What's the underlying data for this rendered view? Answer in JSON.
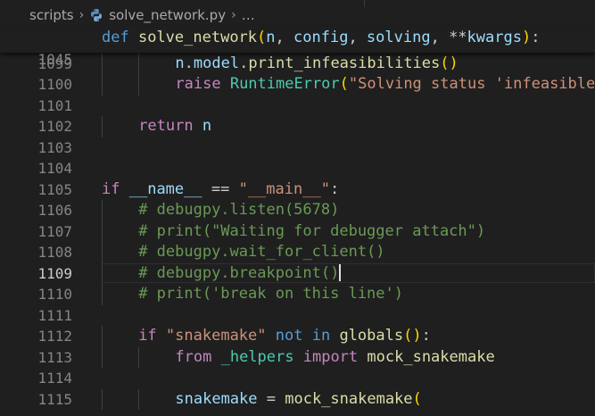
{
  "breadcrumb": {
    "folder": "scripts",
    "file": "solve_network.py",
    "ellipsis": "…"
  },
  "sticky": {
    "line_number": "1045",
    "tokens": [
      {
        "t": "def",
        "c": "kw"
      },
      {
        "t": " ",
        "c": "pl"
      },
      {
        "t": "solve_network",
        "c": "fn"
      },
      {
        "t": "(",
        "c": "p1"
      },
      {
        "t": "n",
        "c": "var"
      },
      {
        "t": ", ",
        "c": "pl"
      },
      {
        "t": "config",
        "c": "var"
      },
      {
        "t": ", ",
        "c": "pl"
      },
      {
        "t": "solving",
        "c": "var"
      },
      {
        "t": ", ",
        "c": "pl"
      },
      {
        "t": "**",
        "c": "pl"
      },
      {
        "t": "kwargs",
        "c": "var"
      },
      {
        "t": ")",
        "c": "p1"
      },
      {
        "t": ":",
        "c": "pl"
      }
    ]
  },
  "active_line": "1109",
  "lines": [
    {
      "n": "1099",
      "indent": 2,
      "tokens": [
        {
          "t": "n",
          "c": "var"
        },
        {
          "t": ".",
          "c": "pl"
        },
        {
          "t": "model",
          "c": "var"
        },
        {
          "t": ".",
          "c": "pl"
        },
        {
          "t": "print_infeasibilities",
          "c": "fn"
        },
        {
          "t": "()",
          "c": "p1"
        }
      ]
    },
    {
      "n": "1100",
      "indent": 2,
      "tokens": [
        {
          "t": "raise",
          "c": "ctl"
        },
        {
          "t": " ",
          "c": "pl"
        },
        {
          "t": "RuntimeError",
          "c": "cls"
        },
        {
          "t": "(",
          "c": "p1"
        },
        {
          "t": "\"Solving status 'infeasible'",
          "c": "str"
        }
      ]
    },
    {
      "n": "1101",
      "indent": 0,
      "tokens": []
    },
    {
      "n": "1102",
      "indent": 1,
      "tokens": [
        {
          "t": "return",
          "c": "ctl"
        },
        {
          "t": " ",
          "c": "pl"
        },
        {
          "t": "n",
          "c": "var"
        }
      ]
    },
    {
      "n": "1103",
      "indent": 0,
      "tokens": []
    },
    {
      "n": "1104",
      "indent": 0,
      "tokens": []
    },
    {
      "n": "1105",
      "indent": 0,
      "tokens": [
        {
          "t": "if",
          "c": "ctl"
        },
        {
          "t": " ",
          "c": "pl"
        },
        {
          "t": "__name__",
          "c": "var"
        },
        {
          "t": " == ",
          "c": "pl"
        },
        {
          "t": "\"__main__\"",
          "c": "str"
        },
        {
          "t": ":",
          "c": "pl"
        }
      ]
    },
    {
      "n": "1106",
      "indent": 1,
      "tokens": [
        {
          "t": "# debugpy.listen(5678)",
          "c": "cmt"
        }
      ]
    },
    {
      "n": "1107",
      "indent": 1,
      "tokens": [
        {
          "t": "# print(\"Waiting for debugger attach\")",
          "c": "cmt"
        }
      ]
    },
    {
      "n": "1108",
      "indent": 1,
      "tokens": [
        {
          "t": "# debugpy.wait_for_client()",
          "c": "cmt"
        }
      ]
    },
    {
      "n": "1109",
      "indent": 1,
      "caret": true,
      "tokens": [
        {
          "t": "# debugpy.breakpoint()",
          "c": "cmt"
        }
      ]
    },
    {
      "n": "1110",
      "indent": 1,
      "tokens": [
        {
          "t": "# print('break on this line')",
          "c": "cmt"
        }
      ]
    },
    {
      "n": "1111",
      "indent": 0,
      "tokens": []
    },
    {
      "n": "1112",
      "indent": 1,
      "tokens": [
        {
          "t": "if",
          "c": "ctl"
        },
        {
          "t": " ",
          "c": "pl"
        },
        {
          "t": "\"snakemake\"",
          "c": "str"
        },
        {
          "t": " ",
          "c": "pl"
        },
        {
          "t": "not in",
          "c": "kw"
        },
        {
          "t": " ",
          "c": "pl"
        },
        {
          "t": "globals",
          "c": "fn"
        },
        {
          "t": "()",
          "c": "p1"
        },
        {
          "t": ":",
          "c": "pl"
        }
      ]
    },
    {
      "n": "1113",
      "indent": 2,
      "tokens": [
        {
          "t": "from",
          "c": "ctl"
        },
        {
          "t": " ",
          "c": "pl"
        },
        {
          "t": "_helpers",
          "c": "cls"
        },
        {
          "t": " ",
          "c": "pl"
        },
        {
          "t": "import",
          "c": "ctl"
        },
        {
          "t": " ",
          "c": "pl"
        },
        {
          "t": "mock_snakemake",
          "c": "fn"
        }
      ]
    },
    {
      "n": "1114",
      "indent": 0,
      "tokens": []
    },
    {
      "n": "1115",
      "indent": 2,
      "tokens": [
        {
          "t": "snakemake",
          "c": "var"
        },
        {
          "t": " = ",
          "c": "pl"
        },
        {
          "t": "mock_snakemake",
          "c": "fn"
        },
        {
          "t": "(",
          "c": "p1"
        }
      ]
    }
  ]
}
